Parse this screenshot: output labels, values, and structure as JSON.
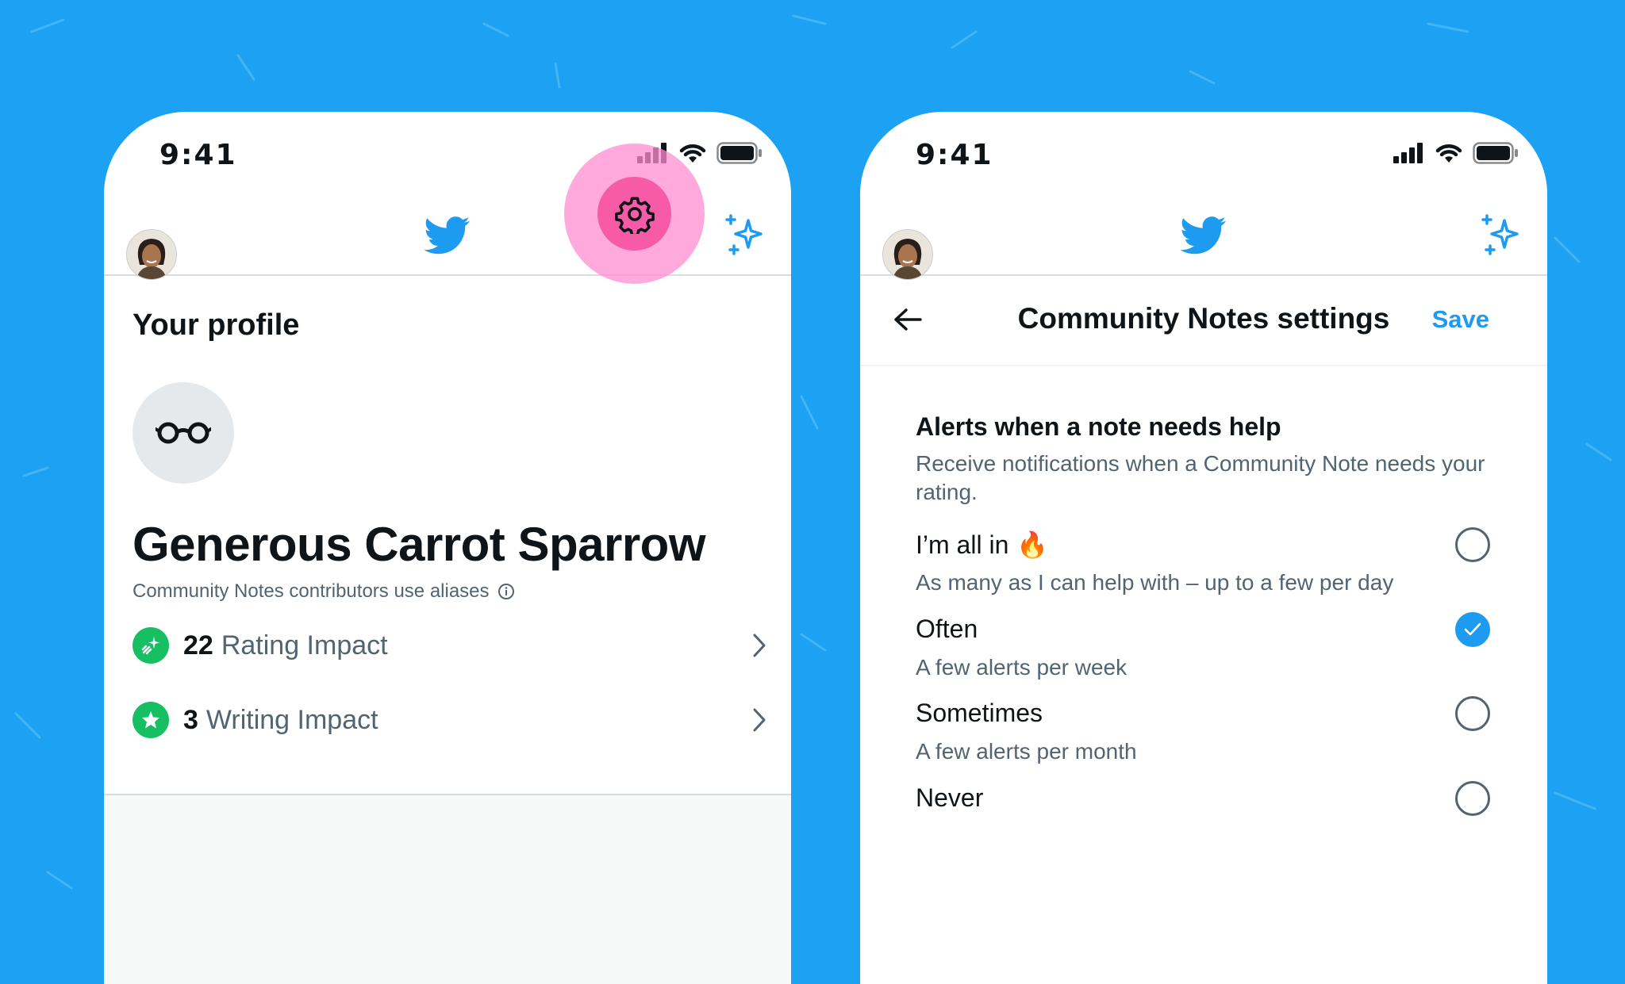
{
  "colors": {
    "background": "#1DA1F2",
    "twitter_blue": "#1D9BF0",
    "highlight_pink": "#F75BA7",
    "impact_green": "#17BF63",
    "secondary_text": "#536471"
  },
  "status_bar": {
    "time": "9:41",
    "icons": [
      "cellular-signal-icon",
      "wifi-icon",
      "battery-icon"
    ]
  },
  "header": {
    "icons": [
      "avatar",
      "twitter-bird-icon",
      "sparkle-icon"
    ]
  },
  "profile_screen": {
    "title": "Your profile",
    "alias_name": "Generous Carrot Sparrow",
    "alias_note": "Community Notes contributors use aliases",
    "impacts": [
      {
        "value": "22",
        "label": "Rating Impact"
      },
      {
        "value": "3",
        "label": "Writing Impact"
      }
    ]
  },
  "settings_screen": {
    "title": "Community Notes settings",
    "save_label": "Save",
    "section_title": "Alerts when a note needs help",
    "section_desc": "Receive notifications when a Community Note needs your rating.",
    "options": [
      {
        "title": "I’m all in",
        "emoji": "🔥",
        "subtitle": "As many as I can help with – up to a few per day",
        "selected": false
      },
      {
        "title": "Often",
        "subtitle": "A few alerts per week",
        "selected": true
      },
      {
        "title": "Sometimes",
        "subtitle": "A few alerts per month",
        "selected": false
      },
      {
        "title": "Never",
        "subtitle": "",
        "selected": false
      }
    ]
  }
}
